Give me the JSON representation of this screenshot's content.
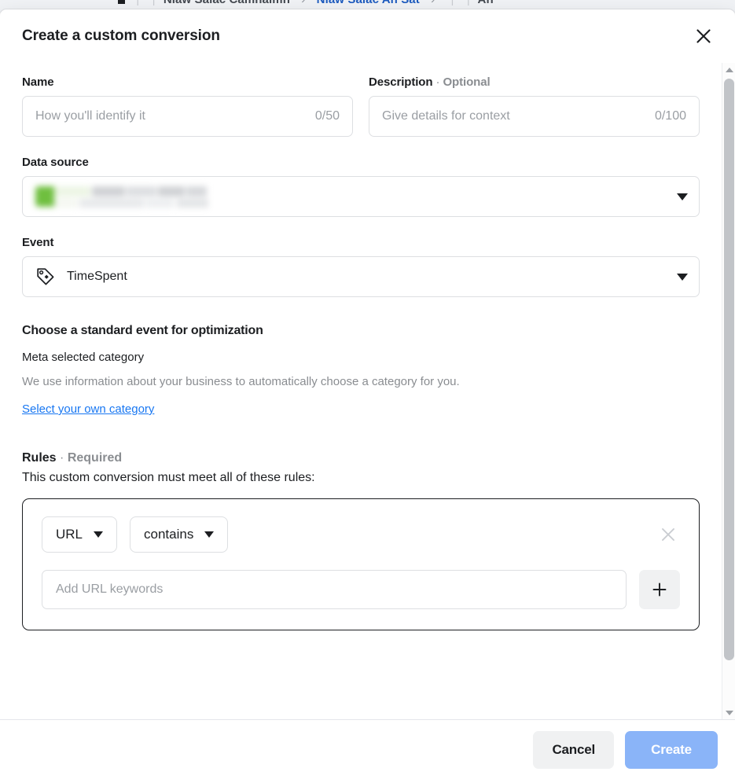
{
  "background": {
    "breadcrumb_fragment_1": "Niaw Saiac Camnaimn",
    "breadcrumb_fragment_2": "Niaw Saiac An Sat",
    "breadcrumb_fragment_3": "An",
    "separator": "›",
    "pipe": "|"
  },
  "dialog": {
    "title": "Create a custom conversion",
    "close_icon": "close-icon"
  },
  "name_field": {
    "label": "Name",
    "placeholder": "How you'll identify it",
    "value": "",
    "counter": "0/50"
  },
  "description_field": {
    "label": "Description",
    "label_separator": "·",
    "label_optional": "Optional",
    "placeholder": "Give details for context",
    "value": "",
    "counter": "0/100"
  },
  "data_source": {
    "label": "Data source",
    "value": "",
    "redacted": true,
    "status_color": "#6fbf3f",
    "caret_icon": "chevron-down-icon"
  },
  "event": {
    "label": "Event",
    "icon": "tag-icon",
    "value": "TimeSpent",
    "caret_icon": "chevron-down-icon"
  },
  "optimization": {
    "title": "Choose a standard event for optimization",
    "selected_label": "Meta selected category",
    "description": "We use information about your business to automatically choose a category for you.",
    "link_label": "Select your own category",
    "link_color": "#1877f2"
  },
  "rules": {
    "heading": "Rules",
    "heading_separator": "·",
    "heading_required": "Required",
    "description": "This custom conversion must meet all of these rules:",
    "rule": {
      "field_select": "URL",
      "operator_select": "contains",
      "remove_icon": "close-icon",
      "keywords_placeholder": "Add URL keywords",
      "keywords_value": "",
      "add_icon": "plus-icon"
    }
  },
  "footer": {
    "cancel_label": "Cancel",
    "create_label": "Create",
    "create_color": "#8ab4f8"
  },
  "scrollbar": {
    "up_icon": "triangle-up-icon",
    "down_icon": "triangle-down-icon"
  }
}
